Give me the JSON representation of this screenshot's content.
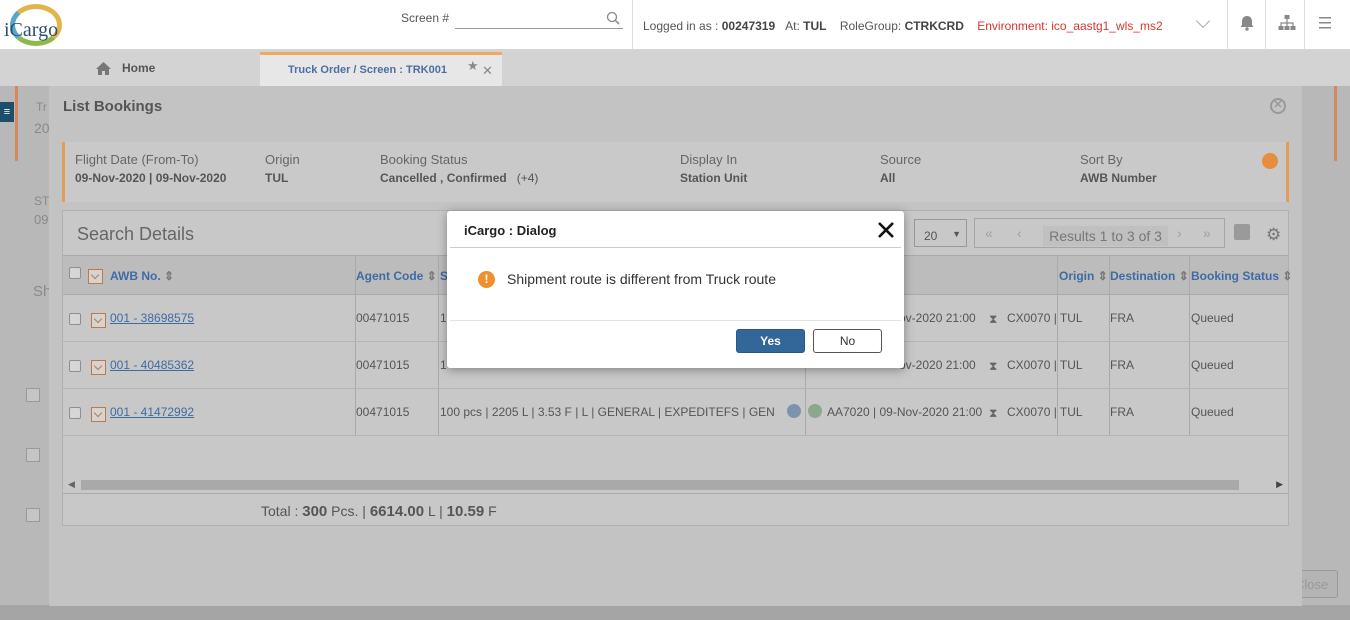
{
  "header": {
    "logo_text": "iCargo",
    "screen_label": "Screen #",
    "screen_value": "",
    "logged_in_label": "Logged in as :",
    "user_id": "00247319",
    "at_label": "At:",
    "station": "TUL",
    "rolegroup_label": "RoleGroup:",
    "rolegroup": "CTRKCRD",
    "environment": "Environment: ico_aastg1_wls_ms2"
  },
  "tabs": {
    "home": "Home",
    "active": "Truck Order / Screen : TRK001"
  },
  "background": {
    "frag1": "Tr",
    "frag2": "20",
    "frag3": "ST",
    "frag4": "09",
    "frag5": "Sh",
    "close_label": "Close"
  },
  "modal": {
    "title": "List Bookings",
    "filters": {
      "flight_date_label": "Flight Date (From-To)",
      "flight_date_value": "09-Nov-2020 | 09-Nov-2020",
      "origin_label": "Origin",
      "origin_value": "TUL",
      "booking_status_label": "Booking Status",
      "booking_status_value": "Cancelled , Confirmed",
      "booking_status_more": "(+4)",
      "display_in_label": "Display In",
      "display_in_value": "Station Unit",
      "source_label": "Source",
      "source_value": "All",
      "sort_by_label": "Sort By",
      "sort_by_value": "AWB Number"
    },
    "grid": {
      "title": "Search Details",
      "page_size": "20",
      "results": "Results 1 to 3 of 3",
      "columns": {
        "awb": "AWB No.",
        "agent": "Agent Code",
        "s": "S",
        "origin": "Origin",
        "destination": "Destination",
        "booking_status": "Booking Status"
      },
      "rows": [
        {
          "awb": "001 - 38698575",
          "agent": "00471015",
          "shipment": "1",
          "flight": "ov-2020 21:00",
          "truck": "CX0070 | TUL",
          "destination": "FRA",
          "status": "Queued"
        },
        {
          "awb": "001 - 40485362",
          "agent": "00471015",
          "shipment": "1",
          "flight": "ov-2020 21:00",
          "truck": "CX0070 | TUL",
          "destination": "FRA",
          "status": "Queued"
        },
        {
          "awb": "001 - 41472992",
          "agent": "00471015",
          "shipment": "100 pcs | 2205 L | 3.53 F | L | GENERAL | EXPEDITEFS | GEN",
          "flight": "AA7020 | 09-Nov-2020 21:00",
          "truck": "CX0070 | TUL",
          "destination": "FRA",
          "status": "Queued"
        }
      ],
      "total_label": "Total :",
      "total_pcs": "300",
      "pcs_unit": "Pcs. |",
      "total_weight": "6614.00",
      "weight_unit": "L |",
      "total_volume": "10.59",
      "volume_unit": "F"
    }
  },
  "dialog": {
    "title": "iCargo : Dialog",
    "message": "Shipment route is different from Truck route",
    "yes_label": "Yes",
    "no_label": "No"
  }
}
